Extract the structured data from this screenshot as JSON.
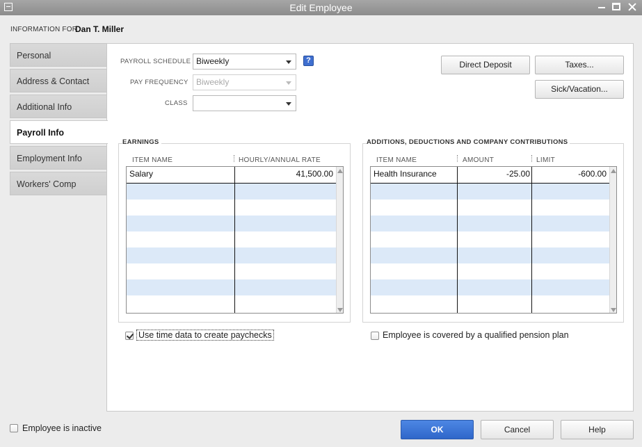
{
  "window": {
    "title": "Edit Employee"
  },
  "header": {
    "info_for_label": "INFORMATION FOR",
    "employee_name": "Dan T. Miller"
  },
  "tabs": [
    {
      "label": "Personal",
      "active": false
    },
    {
      "label": "Address & Contact",
      "active": false
    },
    {
      "label": "Additional Info",
      "active": false
    },
    {
      "label": "Payroll Info",
      "active": true
    },
    {
      "label": "Employment Info",
      "active": false
    },
    {
      "label": "Workers' Comp",
      "active": false
    }
  ],
  "payroll": {
    "schedule_label": "PAYROLL SCHEDULE",
    "schedule_value": "Biweekly",
    "help_label": "?",
    "frequency_label": "PAY FREQUENCY",
    "frequency_value": "Biweekly",
    "class_label": "CLASS",
    "class_value": ""
  },
  "buttons": {
    "direct_deposit": "Direct Deposit",
    "taxes": "Taxes...",
    "sick_vacation": "Sick/Vacation...",
    "ok": "OK",
    "cancel": "Cancel",
    "help": "Help"
  },
  "earnings": {
    "title": "EARNINGS",
    "columns": [
      "ITEM NAME",
      "HOURLY/ANNUAL RATE"
    ],
    "rows": [
      {
        "item": "Salary",
        "rate": "41,500.00"
      }
    ]
  },
  "additions": {
    "title": "ADDITIONS, DEDUCTIONS AND COMPANY CONTRIBUTIONS",
    "columns": [
      "ITEM NAME",
      "AMOUNT",
      "LIMIT"
    ],
    "rows": [
      {
        "item": "Health Insurance",
        "amount": "-25.00",
        "limit": "-600.00"
      }
    ]
  },
  "options": {
    "use_time_data_label": "Use time data to create paychecks",
    "use_time_data_checked": true,
    "pension_label": "Employee is covered by a qualified pension plan",
    "pension_checked": false,
    "inactive_label": "Employee is inactive",
    "inactive_checked": false
  },
  "colors": {
    "titlebar": "#999999",
    "ok_button": "#3a73d6",
    "grid_alt_row": "#dce9f8"
  }
}
